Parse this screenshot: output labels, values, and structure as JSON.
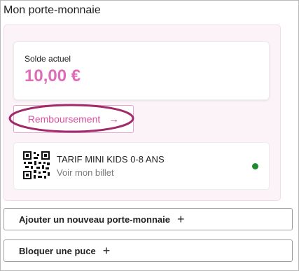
{
  "page": {
    "title": "Mon porte-monnaie"
  },
  "balance": {
    "label": "Solde actuel",
    "amount": "10,00 €",
    "amount_color": "#e06cb7"
  },
  "refund": {
    "label": "Remboursement",
    "arrow_icon": "arrow-right-icon",
    "highlight_color": "#a12a6a"
  },
  "ticket": {
    "title": "TARIF MINI KIDS 0-8 ANS",
    "link": "Voir mon billet",
    "icon": "qr-code-icon",
    "status_color": "#1f8a2e"
  },
  "actions": {
    "add_wallet": "Ajouter un nouveau porte-monnaie",
    "block_chip": "Bloquer une puce",
    "plus_icon": "+"
  }
}
